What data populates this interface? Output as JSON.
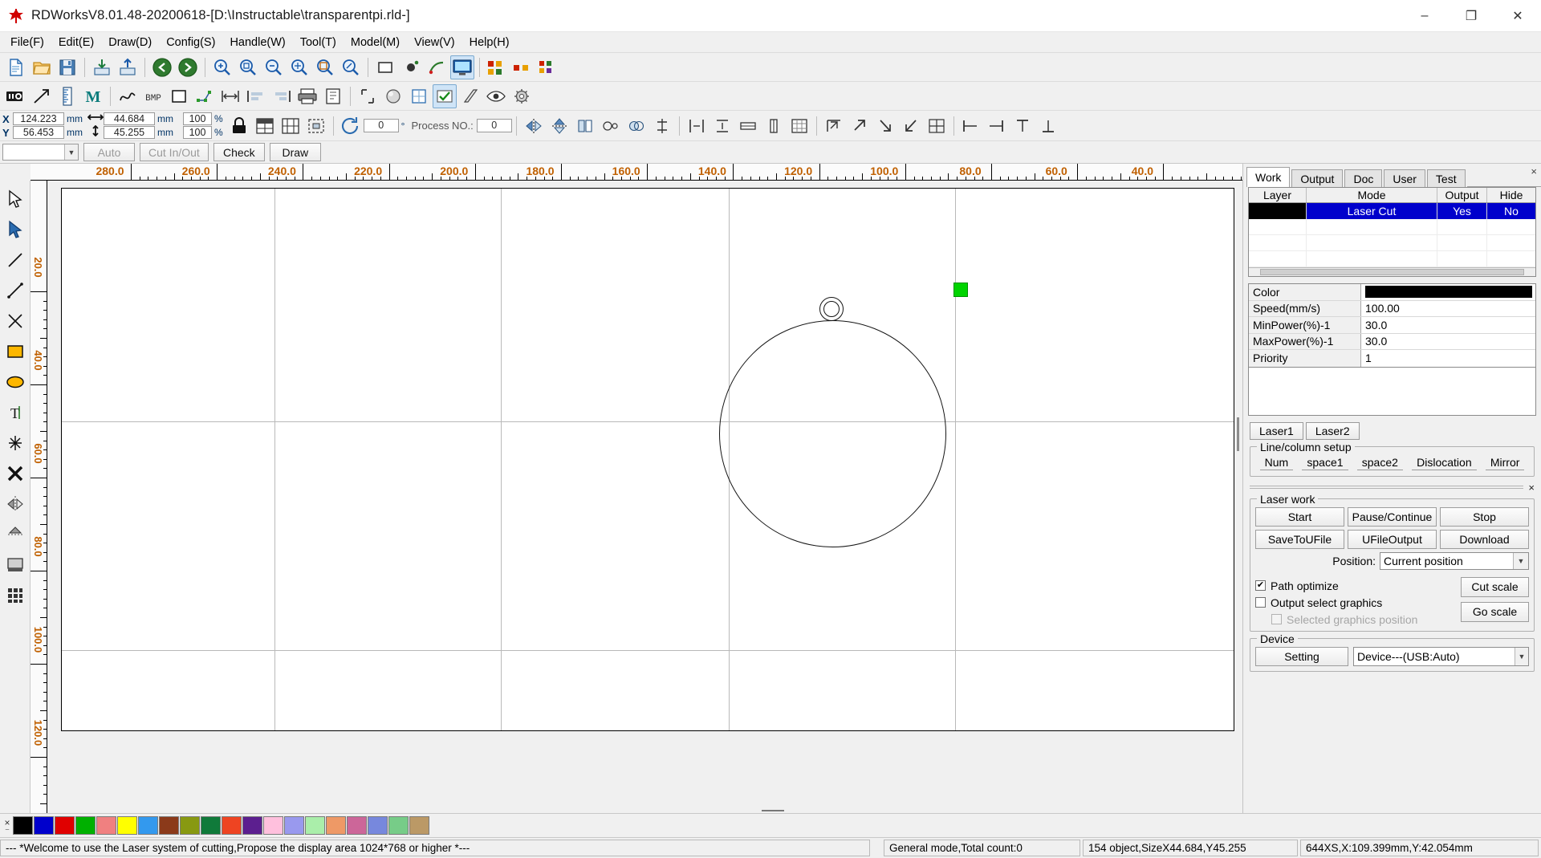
{
  "window": {
    "title": "RDWorksV8.01.48-20200618-[D:\\Instructable\\transparentpi.rld-]",
    "minimize": "–",
    "maximize": "❐",
    "close": "✕"
  },
  "menu": {
    "items": [
      {
        "label": "File(F)"
      },
      {
        "label": "Edit(E)"
      },
      {
        "label": "Draw(D)"
      },
      {
        "label": "Config(S)"
      },
      {
        "label": "Handle(W)"
      },
      {
        "label": "Tool(T)"
      },
      {
        "label": "Model(M)"
      },
      {
        "label": "View(V)"
      },
      {
        "label": "Help(H)"
      }
    ]
  },
  "coordbar": {
    "x_label": "X",
    "y_label": "Y",
    "x_value": "124.223",
    "y_value": "56.453",
    "x_unit": "mm",
    "y_unit": "mm",
    "width_value": "44.684",
    "height_value": "45.255",
    "width_unit": "mm",
    "height_unit": "mm",
    "scale_x": "100",
    "scale_y": "100",
    "pct": "%",
    "rotate_value": "0",
    "rotate_unit": "°",
    "process_no_label": "Process NO.:",
    "process_no_value": "0"
  },
  "actionrow": {
    "combo_value": "",
    "auto": "Auto",
    "cut_in_out": "Cut In/Out",
    "check": "Check",
    "draw": "Draw"
  },
  "rulers": {
    "top_labels": [
      "280.0",
      "260.0",
      "240.0",
      "220.0",
      "200.0",
      "180.0",
      "160.0",
      "140.0",
      "120.0",
      "100.0",
      "80.0",
      "60.0",
      "40.0"
    ],
    "left_labels": [
      "20.0",
      "40.0",
      "60.0",
      "80.0",
      "100.0",
      "120.0"
    ]
  },
  "canvas": {
    "shape_name": "circle-with-ring",
    "marker_color": "#00d400"
  },
  "rightpanel": {
    "close_icon": "×",
    "tabs": [
      {
        "label": "Work",
        "selected": true
      },
      {
        "label": "Output",
        "selected": false
      },
      {
        "label": "Doc",
        "selected": false
      },
      {
        "label": "User",
        "selected": false
      },
      {
        "label": "Test",
        "selected": false
      }
    ],
    "layer_table": {
      "headers": [
        "Layer",
        "Mode",
        "Output",
        "Hide"
      ],
      "rows": [
        {
          "layer_color": "#000000",
          "mode": "Laser Cut",
          "output": "Yes",
          "hide": "No",
          "selected": true
        }
      ]
    },
    "properties": [
      {
        "key": "Color",
        "value": "",
        "is_color": true,
        "color": "#000000"
      },
      {
        "key": "Speed(mm/s)",
        "value": "100.00",
        "is_color": false
      },
      {
        "key": "MinPower(%)-1",
        "value": "30.0",
        "is_color": false
      },
      {
        "key": "MaxPower(%)-1",
        "value": "30.0",
        "is_color": false
      },
      {
        "key": "Priority",
        "value": "1",
        "is_color": false
      }
    ],
    "laser_tabs": [
      {
        "label": "Laser1"
      },
      {
        "label": "Laser2"
      }
    ],
    "line_column_setup": {
      "title": "Line/column setup",
      "items": [
        "Num",
        "space1",
        "space2",
        "Dislocation",
        "Mirror"
      ]
    },
    "laser_work": {
      "title": "Laser work",
      "start": "Start",
      "pause_continue": "Pause/Continue",
      "stop": "Stop",
      "save_to_ufile": "SaveToUFile",
      "ufile_output": "UFileOutput",
      "download": "Download",
      "position_label": "Position:",
      "position_value": "Current position",
      "path_optimize_label": "Path optimize",
      "path_optimize_checked": true,
      "output_select_graphics_label": "Output select graphics",
      "output_select_graphics_checked": false,
      "selected_graphics_position_label": "Selected graphics position",
      "selected_graphics_position_checked": false,
      "cut_scale": "Cut scale",
      "go_scale": "Go scale",
      "check_glyph": "✔"
    },
    "device": {
      "title": "Device",
      "setting": "Setting",
      "device_value": "Device---(USB:Auto)"
    },
    "dropdown_arrow": "▼"
  },
  "colorbar": {
    "close_icon": "×",
    "swatches": [
      "#000000",
      "#0000cc",
      "#e00000",
      "#00b000",
      "#f08080",
      "#ffff00",
      "#3399ee",
      "#8b3a1a",
      "#889911",
      "#107a3a",
      "#ee4422",
      "#5c1f8f",
      "#ffc0dd",
      "#9999ee",
      "#aaeeaa",
      "#ee9966",
      "#cc6699",
      "#7788dd",
      "#77cc88",
      "#bb9966"
    ]
  },
  "statusbar": {
    "message": "--- *Welcome to use the Laser system of cutting,Propose the display area 1024*768 or higher *---",
    "mode": "General mode,Total count:0",
    "objects": "154 object,SizeX44.684,Y45.255",
    "coords": "644XS,X:109.399mm,Y:42.054mm"
  }
}
